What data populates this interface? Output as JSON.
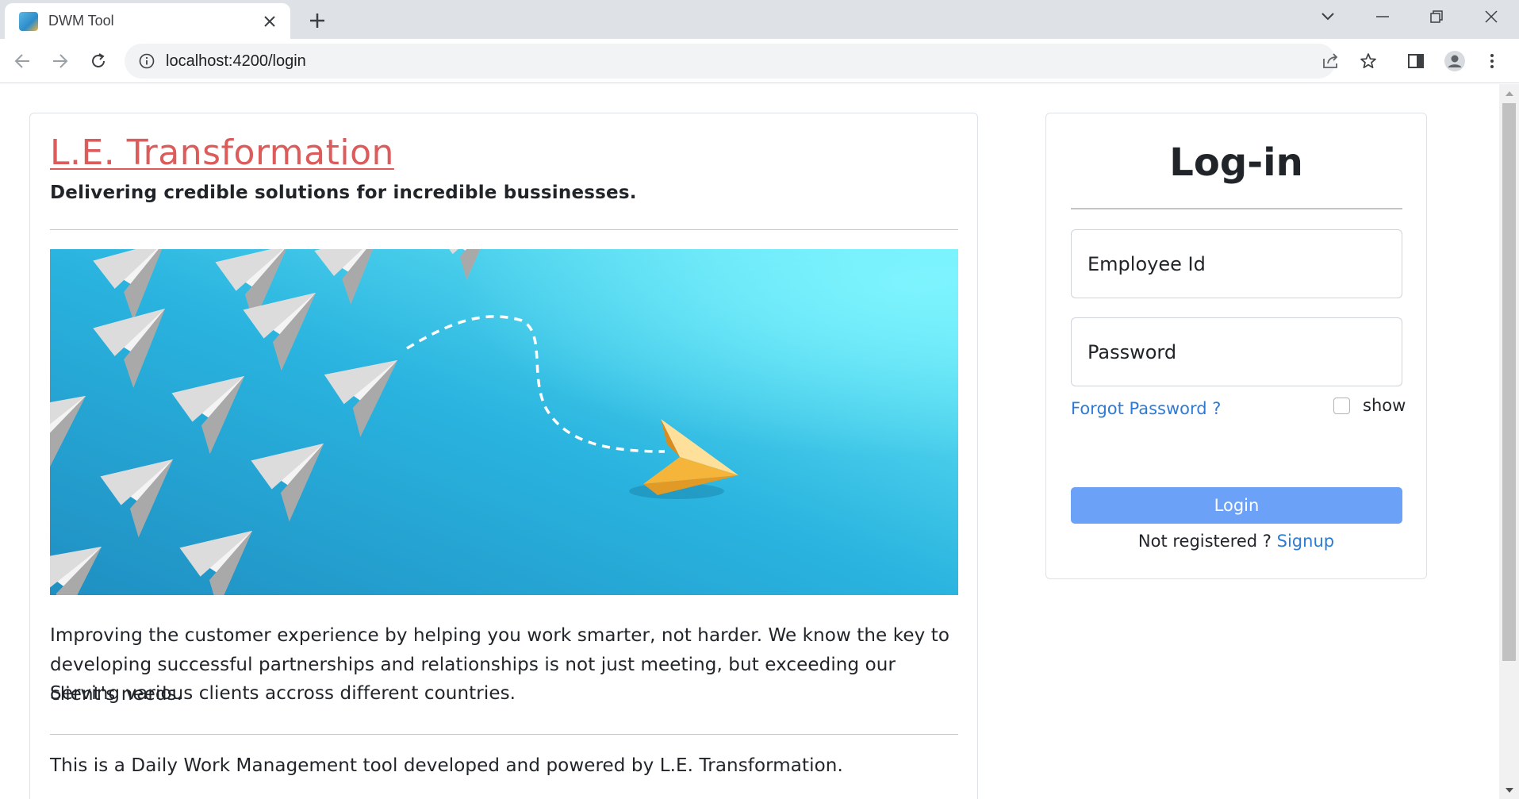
{
  "browser": {
    "tab_title": "DWM Tool",
    "url": "localhost:4200/login"
  },
  "brand": {
    "title": "L.E. Transformation",
    "subtitle": "Delivering credible solutions for incredible bussinesses."
  },
  "content": {
    "paragraph_1": "Improving the customer experience by helping you work smarter, not harder. We know the key to developing successful partnerships and relationships is not just meeting, but exceeding our client's needs.",
    "paragraph_2": "Serving various clients accross different countries.",
    "paragraph_3": "This is a Daily Work Management tool developed and powered by L.E. Transformation."
  },
  "login": {
    "title": "Log-in",
    "employee_id_placeholder": "Employee Id",
    "password_placeholder": "Password",
    "forgot_password": "Forgot Password ?",
    "show_label": "show",
    "login_button": "Login",
    "not_registered": "Not registered ?",
    "signup": "Signup"
  },
  "colors": {
    "brand_title": "#dc5b5b",
    "link": "#2e7bd6",
    "login_button": "#6ba1f6",
    "hero_background": "#2fb2de",
    "hero_plane_accent": "#f5b53a"
  }
}
